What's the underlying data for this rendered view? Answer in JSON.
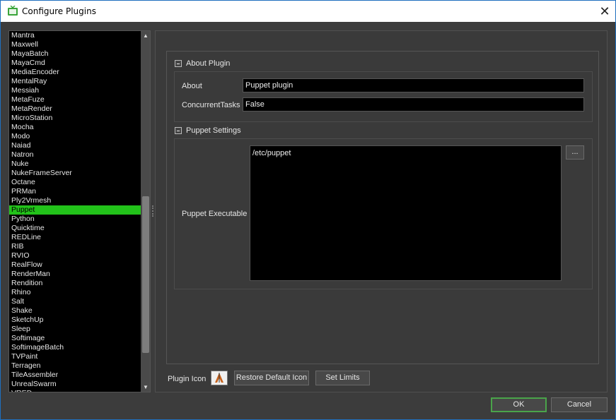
{
  "window": {
    "title": "Configure Plugins",
    "close_glyph": "✕",
    "app_icon": "tv-icon"
  },
  "plugin_list": {
    "items": [
      "Mantra",
      "Maxwell",
      "MayaBatch",
      "MayaCmd",
      "MediaEncoder",
      "MentalRay",
      "Messiah",
      "MetaFuze",
      "MetaRender",
      "MicroStation",
      "Mocha",
      "Modo",
      "Naiad",
      "Natron",
      "Nuke",
      "NukeFrameServer",
      "Octane",
      "PRMan",
      "Ply2Vrmesh",
      "Puppet",
      "Python",
      "Quicktime",
      "REDLine",
      "RIB",
      "RVIO",
      "RealFlow",
      "RenderMan",
      "Rendition",
      "Rhino",
      "Salt",
      "Shake",
      "SketchUp",
      "Sleep",
      "Softimage",
      "SoftimageBatch",
      "TVPaint",
      "Terragen",
      "TileAssembler",
      "UnrealSwarm",
      "VRED"
    ],
    "selected": "Puppet"
  },
  "about_section": {
    "header": "About Plugin",
    "about_label": "About",
    "about_value": "Puppet plugin",
    "concurrent_label": "ConcurrentTasks",
    "concurrent_value": "False"
  },
  "puppet_section": {
    "header": "Puppet Settings",
    "executable_label": "Puppet Executable",
    "executable_value": "/etc/puppet",
    "browse_label": "..."
  },
  "bottom_bar": {
    "plugin_icon_label": "Plugin Icon",
    "restore_label": "Restore Default Icon",
    "set_limits_label": "Set Limits"
  },
  "dialog_buttons": {
    "ok_label": "OK",
    "cancel_label": "Cancel"
  },
  "colors": {
    "selection": "#22c21a",
    "ok_border": "#4aa44a",
    "background": "#3c3c3c"
  }
}
